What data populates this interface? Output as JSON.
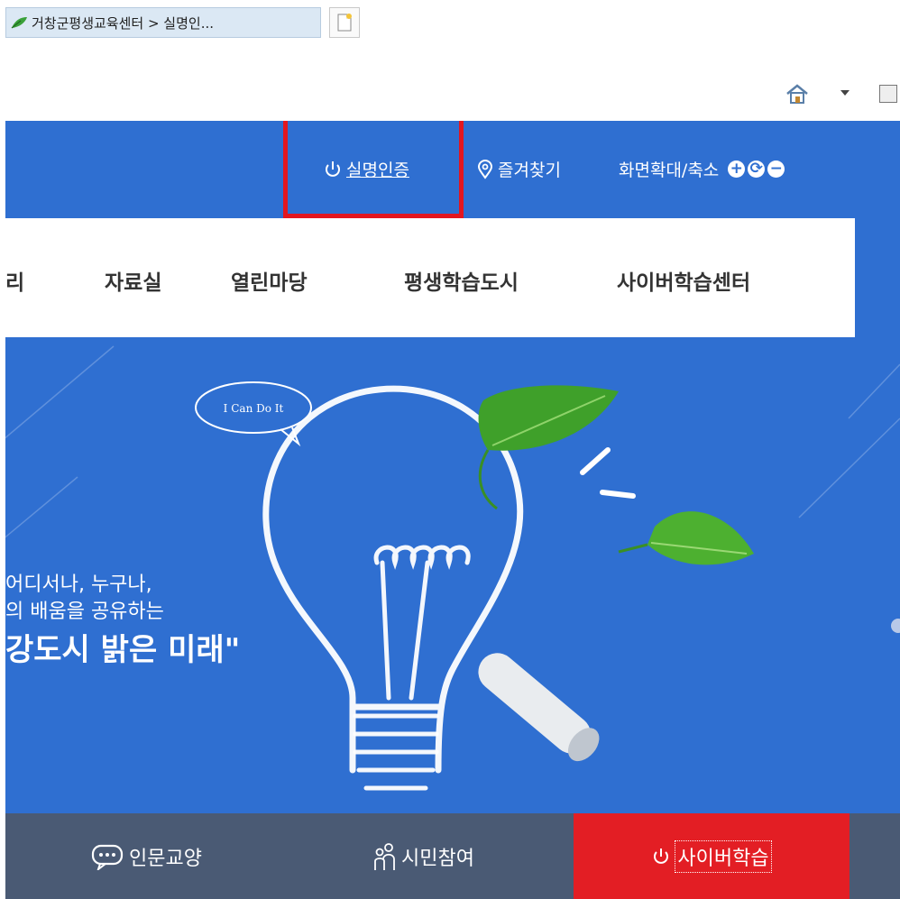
{
  "browser": {
    "tab_title": "거창군평생교육센터 > 실명인...",
    "favicon": "green-leaf-icon",
    "new_tab_icon": "new-tab-icon",
    "home_icon": "home-icon",
    "feeds_icon": "feeds-icon"
  },
  "header": {
    "auth_label": "실명인증",
    "favorites_label": "즐겨찾기",
    "zoom_label": "화면확대/축소",
    "zoom_in": "+",
    "zoom_reset": "⟳",
    "zoom_out": "−"
  },
  "gnb": {
    "items": [
      "리",
      "자료실",
      "열린마당",
      "평생학습도시",
      "사이버학습센터"
    ]
  },
  "hero": {
    "bubble_text": "I Can Do It",
    "line1": "어디서나, 누구나,",
    "line2": "의 배움을 공유하는",
    "line3": "강도시 밝은 미래\""
  },
  "bottom_nav": {
    "items": [
      {
        "label": "인문교양",
        "icon": "speech-bubble-icon"
      },
      {
        "label": "시민참여",
        "icon": "people-icon"
      },
      {
        "label": "사이버학습",
        "icon": "power-icon"
      }
    ]
  },
  "colors": {
    "hero_blue": "#2f6fd1",
    "gnb_bg": "#ffffff",
    "bottom_nav_bg": "#4a5a74",
    "active_red": "#e31e24",
    "highlight_red": "#e3161f"
  }
}
